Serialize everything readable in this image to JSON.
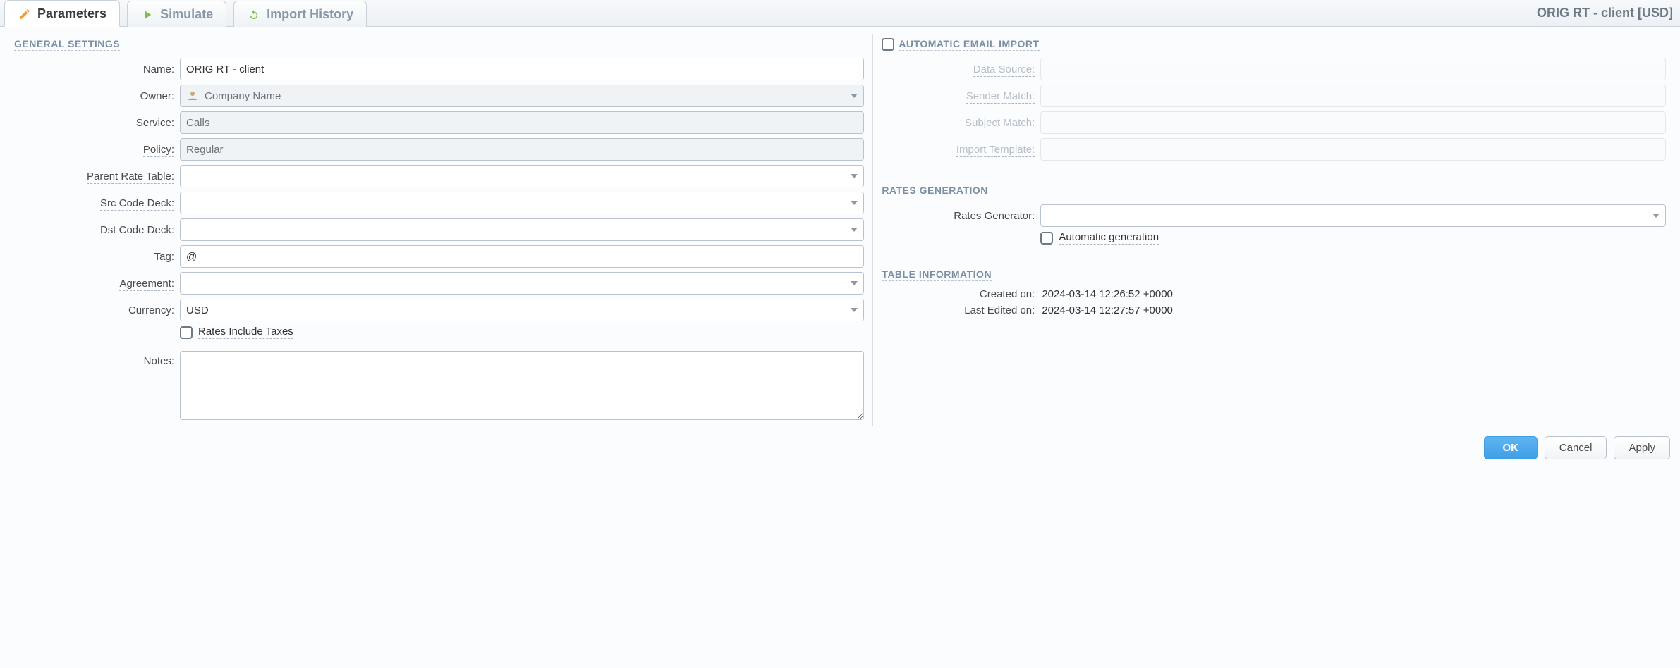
{
  "header": {
    "page_title": "ORIG RT - client [USD]",
    "tabs": [
      {
        "label": "Parameters",
        "icon": "pencil-icon",
        "active": true
      },
      {
        "label": "Simulate",
        "icon": "play-icon",
        "active": false
      },
      {
        "label": "Import History",
        "icon": "refresh-icon",
        "active": false
      }
    ]
  },
  "general": {
    "title": "GENERAL SETTINGS",
    "name": {
      "label": "Name:",
      "value": "ORIG RT - client"
    },
    "owner": {
      "label": "Owner:",
      "value": "Company Name",
      "icon": "user-icon"
    },
    "service": {
      "label": "Service:",
      "value": "Calls"
    },
    "policy": {
      "label": "Policy:",
      "value": "Regular"
    },
    "parent_rate_table": {
      "label": "Parent Rate Table:",
      "value": ""
    },
    "src_code_deck": {
      "label": "Src Code Deck:",
      "value": ""
    },
    "dst_code_deck": {
      "label": "Dst Code Deck:",
      "value": ""
    },
    "tag": {
      "label": "Tag:",
      "value": "@"
    },
    "agreement": {
      "label": "Agreement:",
      "value": ""
    },
    "currency": {
      "label": "Currency:",
      "value": "USD"
    },
    "rates_include_taxes": {
      "label": "Rates Include Taxes",
      "checked": false
    },
    "notes": {
      "label": "Notes:",
      "value": ""
    }
  },
  "email_import": {
    "title": "AUTOMATIC EMAIL IMPORT",
    "enabled": false,
    "data_source": {
      "label": "Data Source:",
      "value": ""
    },
    "sender_match": {
      "label": "Sender Match:",
      "value": ""
    },
    "subject_match": {
      "label": "Subject Match:",
      "value": ""
    },
    "import_template": {
      "label": "Import Template:",
      "value": ""
    }
  },
  "rates_generation": {
    "title": "RATES GENERATION",
    "rates_generator": {
      "label": "Rates Generator:",
      "value": ""
    },
    "automatic_generation": {
      "label": "Automatic generation",
      "checked": false
    }
  },
  "table_info": {
    "title": "TABLE INFORMATION",
    "created_on": {
      "label": "Created on:",
      "value": "2024-03-14 12:26:52 +0000"
    },
    "last_edited_on": {
      "label": "Last Edited on:",
      "value": "2024-03-14 12:27:57 +0000"
    }
  },
  "buttons": {
    "ok": "OK",
    "cancel": "Cancel",
    "apply": "Apply"
  }
}
